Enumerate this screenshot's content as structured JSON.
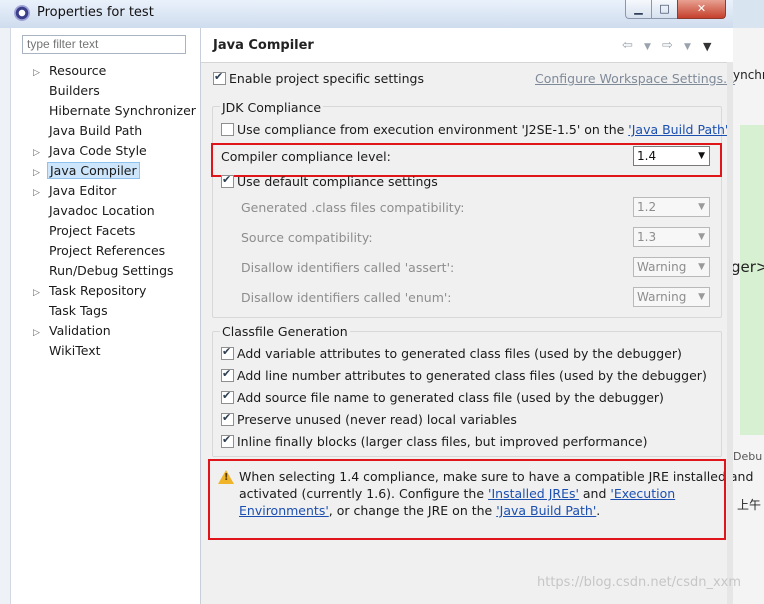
{
  "window": {
    "title": "Properties for test"
  },
  "filter": {
    "placeholder": "type filter text"
  },
  "tree": [
    {
      "label": "Resource",
      "expandable": true
    },
    {
      "label": "Builders",
      "expandable": false
    },
    {
      "label": "Hibernate Synchronizer",
      "expandable": false
    },
    {
      "label": "Java Build Path",
      "expandable": false
    },
    {
      "label": "Java Code Style",
      "expandable": true
    },
    {
      "label": "Java Compiler",
      "expandable": true,
      "selected": true
    },
    {
      "label": "Java Editor",
      "expandable": true
    },
    {
      "label": "Javadoc Location",
      "expandable": false
    },
    {
      "label": "Project Facets",
      "expandable": false
    },
    {
      "label": "Project References",
      "expandable": false
    },
    {
      "label": "Run/Debug Settings",
      "expandable": false
    },
    {
      "label": "Task Repository",
      "expandable": true
    },
    {
      "label": "Task Tags",
      "expandable": false
    },
    {
      "label": "Validation",
      "expandable": true
    },
    {
      "label": "WikiText",
      "expandable": false
    }
  ],
  "page": {
    "title": "Java Compiler",
    "enable_specific": "Enable project specific settings",
    "configure_link": "Configure Workspace Settings...",
    "jdk": {
      "heading": "JDK Compliance",
      "use_env_prefix": "Use compliance from execution environment 'J2SE-1.5' on the ",
      "use_env_link": "'Java Build Path'",
      "level_label": "Compiler compliance level:",
      "level_value": "1.4",
      "use_default": "Use default compliance settings",
      "rows": [
        {
          "label": "Generated .class files compatibility:",
          "value": "1.2"
        },
        {
          "label": "Source compatibility:",
          "value": "1.3"
        },
        {
          "label": "Disallow identifiers called 'assert':",
          "value": "Warning"
        },
        {
          "label": "Disallow identifiers called 'enum':",
          "value": "Warning"
        }
      ]
    },
    "classfile": {
      "heading": "Classfile Generation",
      "options": [
        "Add variable attributes to generated class files (used by the debugger)",
        "Add line number attributes to generated class files (used by the debugger)",
        "Add source file name to generated class file (used by the debugger)",
        "Preserve unused (never read) local variables",
        "Inline finally blocks (larger class files, but improved performance)"
      ]
    },
    "warning": {
      "line1": "When selecting 1.4 compliance, make sure to have a compatible JRE installed and",
      "line2_prefix": "activated (currently 1.6). Configure the ",
      "link_jres": "'Installed JREs'",
      "and": " and ",
      "link_exec1": "'Execution",
      "link_exec2": "Environments'",
      "line3_mid": ", or change the JRE on the ",
      "link_build": "'Java Build Path'",
      "line3_end": "."
    }
  },
  "background": {
    "frag_synchr": "ynchr",
    "frag_gerx": "ger>",
    "frag_debug": "Debu",
    "frag_am": "上午"
  },
  "watermark": "https://blog.csdn.net/csdn_xxm",
  "colors": {
    "highlight_box": "#e0141b",
    "selection": "#cde6fb",
    "link": "#1b4fb0"
  }
}
